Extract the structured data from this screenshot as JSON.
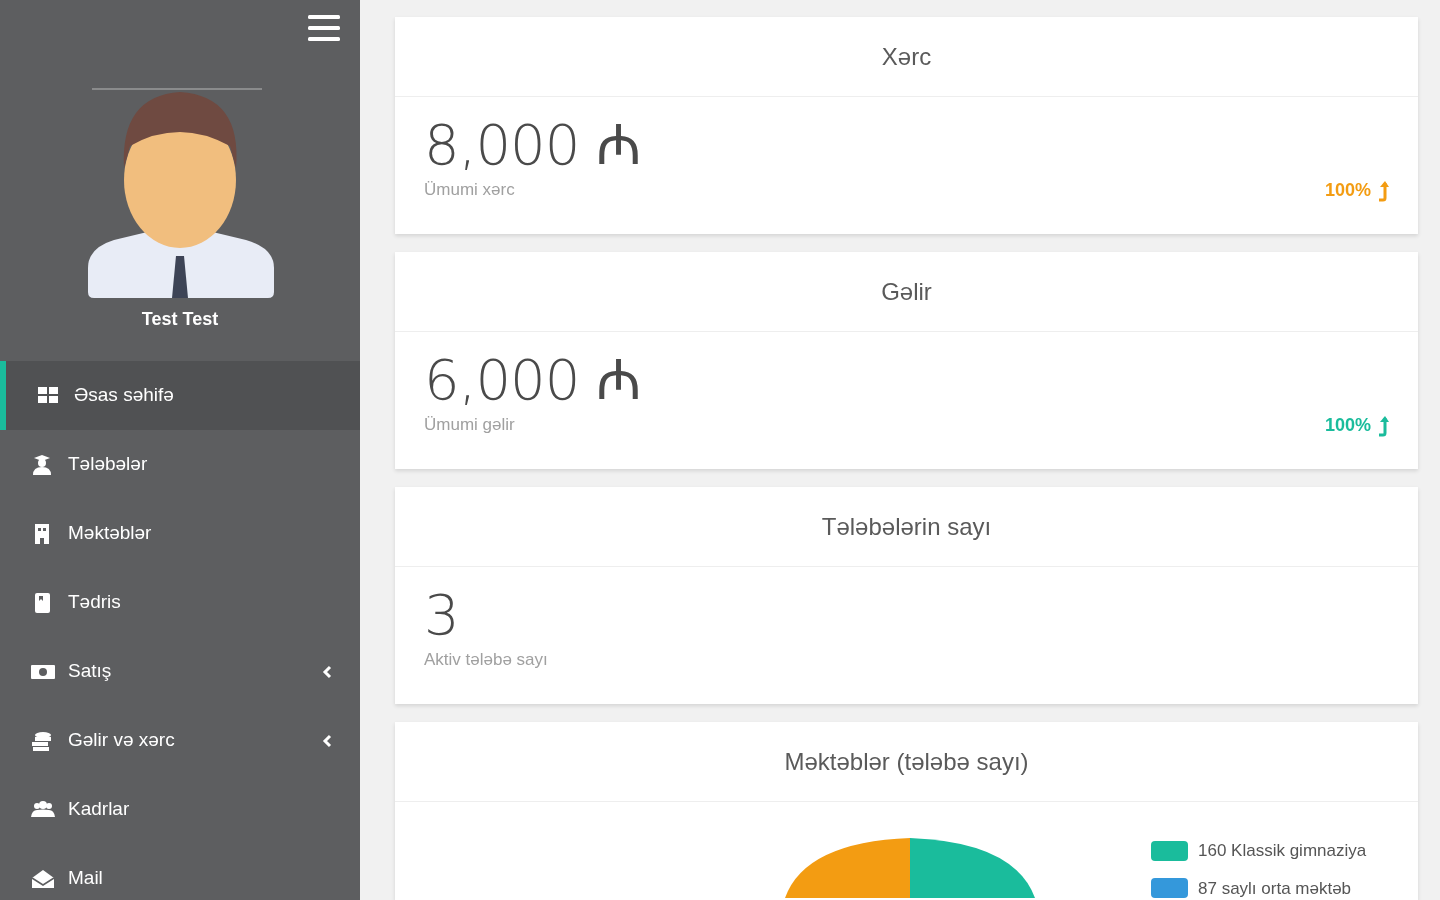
{
  "sidebar": {
    "user_name": "Test Test",
    "items": [
      {
        "label": "Əsas səhifə",
        "kind": "grid",
        "selected": true,
        "has_submenu": false
      },
      {
        "label": "Tələbələr",
        "kind": "student",
        "selected": false,
        "has_submenu": false
      },
      {
        "label": "Məktəblər",
        "kind": "building",
        "selected": false,
        "has_submenu": false
      },
      {
        "label": "Tədris",
        "kind": "book",
        "selected": false,
        "has_submenu": false
      },
      {
        "label": "Satış",
        "kind": "money",
        "selected": false,
        "has_submenu": true
      },
      {
        "label": "Gəlir və xərc",
        "kind": "coins",
        "selected": false,
        "has_submenu": true
      },
      {
        "label": "Kadrlar",
        "kind": "users",
        "selected": false,
        "has_submenu": false
      },
      {
        "label": "Mail",
        "kind": "mail",
        "selected": false,
        "has_submenu": false
      }
    ]
  },
  "cards": [
    {
      "title": "Xərc",
      "value": "8,000 ₼",
      "caption": "Ümumi xərc",
      "trend": {
        "text": "100%",
        "color": "#f39c12"
      }
    },
    {
      "title": "Gəlir",
      "value": "6,000 ₼",
      "caption": "Ümumi gəlir",
      "trend": {
        "text": "100%",
        "color": "#1abc9c"
      }
    },
    {
      "title": "Tələbələrin sayı",
      "value": "3",
      "caption": "Aktiv tələbə sayı"
    }
  ],
  "chart_card": {
    "title": "Məktəblər (tələbə sayı)",
    "legend": [
      {
        "label": "160 Klassik gimnaziya",
        "color": "#1abc9c"
      },
      {
        "label": "87 saylı orta məktəb",
        "color": "#3498db"
      }
    ]
  }
}
